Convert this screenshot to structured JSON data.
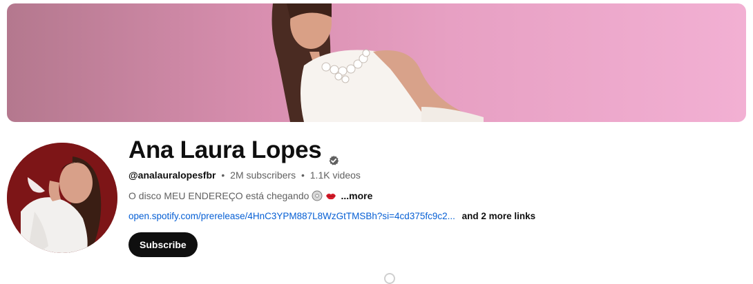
{
  "channel": {
    "name": "Ana Laura Lopes",
    "handle": "@analauralopesfbr",
    "subscribers": "2M subscribers",
    "videos": "1.1K videos",
    "separator": "•",
    "description": "O disco MEU ENDEREÇO está chegando",
    "more_label": "...more",
    "link_text": "open.spotify.com/prerelease/4HnC3YPM887L8WzGtTMSBh?si=4cd375fc9c2...",
    "more_links_label": "and 2 more links",
    "subscribe_label": "Subscribe"
  },
  "icons": {
    "verified": "verified-badge-icon",
    "emoji_disc": "disc-emoji",
    "emoji_lips": "lips-emoji"
  },
  "colors": {
    "link": "#065fd4",
    "button_bg": "#0f0f0f",
    "banner_pink": "#e7a0c3"
  }
}
